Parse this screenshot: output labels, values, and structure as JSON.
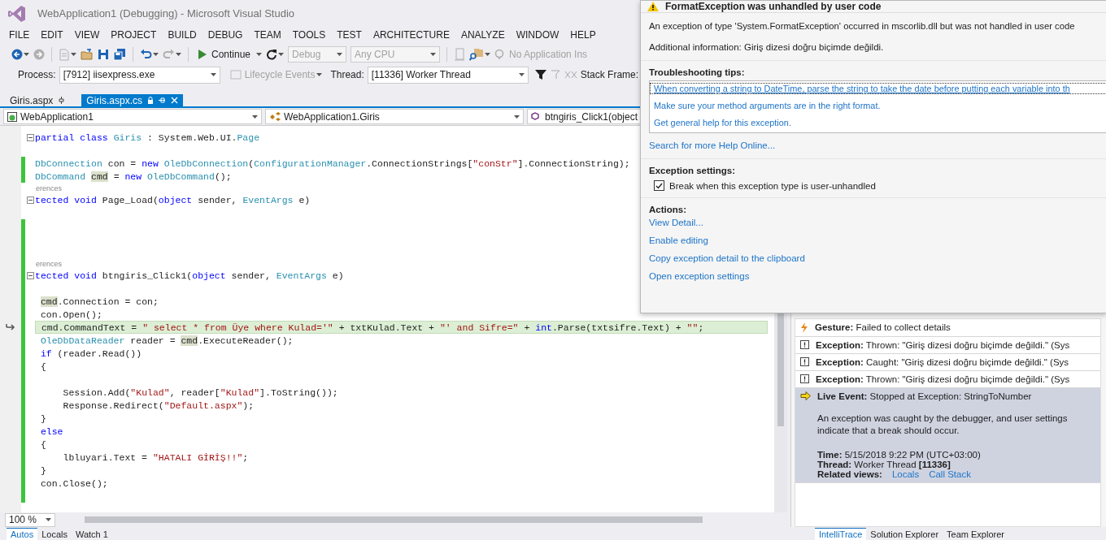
{
  "window": {
    "title": "WebApplication1 (Debugging) - Microsoft Visual Studio"
  },
  "menu": [
    "FILE",
    "EDIT",
    "VIEW",
    "PROJECT",
    "BUILD",
    "DEBUG",
    "TEAM",
    "TOOLS",
    "TEST",
    "ARCHITECTURE",
    "ANALYZE",
    "WINDOW",
    "HELP"
  ],
  "toolbar": {
    "items": [
      {
        "kind": "back",
        "disabled": false
      },
      {
        "kind": "forward",
        "disabled": true
      },
      {
        "kind": "sep"
      },
      {
        "kind": "new-item",
        "disabled": true
      },
      {
        "kind": "open",
        "disabled": false
      },
      {
        "kind": "save",
        "disabled": false
      },
      {
        "kind": "save-all",
        "disabled": false
      },
      {
        "kind": "sep"
      },
      {
        "kind": "undo",
        "disabled": false
      },
      {
        "kind": "redo",
        "disabled": true
      },
      {
        "kind": "sep"
      },
      {
        "kind": "continue",
        "label": "Continue",
        "disabled": false
      },
      {
        "kind": "restart",
        "disabled": false
      },
      {
        "kind": "combo",
        "label": "Debug",
        "disabled": true
      },
      {
        "kind": "combo",
        "label": "Any CPU",
        "disabled": true
      },
      {
        "kind": "sep"
      },
      {
        "kind": "device",
        "disabled": true
      },
      {
        "kind": "find",
        "disabled": false
      },
      {
        "kind": "insights",
        "label": "No Application Ins",
        "disabled": true
      }
    ]
  },
  "debug_bar": {
    "process_label": "Process:",
    "process": "[7912] iisexpress.exe",
    "lifecycle": {
      "label": "Lifecycle Events",
      "disabled": true
    },
    "thread_label": "Thread:",
    "thread": "[11336] Worker Thread",
    "stack_label": "Stack Frame:"
  },
  "doc_tabs": [
    {
      "label": "Giris.aspx",
      "selected": false
    },
    {
      "label": "Giris.aspx.cs",
      "selected": true
    }
  ],
  "nav_bar": [
    "WebApplication1",
    "WebApplication1.Giris",
    "btngiris_Click1(object"
  ],
  "code_lines": [
    {
      "kind": "code",
      "changed": false,
      "fold": true,
      "current": false,
      "tokens": [
        {
          "t": "partial class ",
          "kind": "kw"
        },
        {
          "t": "Giris",
          "kind": "type"
        },
        {
          "t": " : System.Web.UI.",
          "kind": "plain"
        },
        {
          "t": "Page",
          "kind": "type"
        }
      ]
    },
    {
      "kind": "blank",
      "changed": false
    },
    {
      "kind": "code",
      "changed": true,
      "fold": false,
      "current": false,
      "tokens": [
        {
          "t": "DbConnection",
          "kind": "type"
        },
        {
          "t": " con = ",
          "kind": "plain"
        },
        {
          "t": "new ",
          "kind": "kw"
        },
        {
          "t": "OleDbConnection",
          "kind": "type"
        },
        {
          "t": "(",
          "kind": "plain"
        },
        {
          "t": "ConfigurationManager",
          "kind": "type"
        },
        {
          "t": ".ConnectionStrings[",
          "kind": "plain"
        },
        {
          "t": "\"conStr\"",
          "kind": "str"
        },
        {
          "t": "].ConnectionString);",
          "kind": "plain"
        }
      ]
    },
    {
      "kind": "code",
      "changed": true,
      "fold": false,
      "current": false,
      "tokens": [
        {
          "t": "DbCommand",
          "kind": "type"
        },
        {
          "t": " cmd",
          "kind": "ref"
        },
        {
          "t": " = ",
          "kind": "plain"
        },
        {
          "t": "new ",
          "kind": "kw"
        },
        {
          "t": "OleDbCommand",
          "kind": "type"
        },
        {
          "t": "();",
          "kind": "plain"
        }
      ]
    },
    {
      "kind": "codelens",
      "changed": false,
      "text": "erences"
    },
    {
      "kind": "code",
      "changed": false,
      "fold": true,
      "current": false,
      "tokens": [
        {
          "t": "tected void",
          "kind": "kw"
        },
        {
          "t": " Page_Load(",
          "kind": "plain"
        },
        {
          "t": "object",
          "kind": "kw"
        },
        {
          "t": " sender, ",
          "kind": "plain"
        },
        {
          "t": "EventArgs",
          "kind": "type"
        },
        {
          "t": " e)",
          "kind": "plain"
        }
      ]
    },
    {
      "kind": "blank",
      "changed": false
    },
    {
      "kind": "blank",
      "changed": true
    },
    {
      "kind": "blank",
      "changed": true
    },
    {
      "kind": "blank",
      "changed": true
    },
    {
      "kind": "codelens",
      "changed": true,
      "text": "erences"
    },
    {
      "kind": "code",
      "changed": true,
      "fold": true,
      "current": false,
      "tokens": [
        {
          "t": "tected void",
          "kind": "kw"
        },
        {
          "t": " btngiris_Click1(",
          "kind": "plain"
        },
        {
          "t": "object",
          "kind": "kw"
        },
        {
          "t": " sender, ",
          "kind": "plain"
        },
        {
          "t": "EventArgs",
          "kind": "type"
        },
        {
          "t": " e)",
          "kind": "plain"
        }
      ]
    },
    {
      "kind": "blank",
      "changed": true
    },
    {
      "kind": "code",
      "changed": true,
      "fold": false,
      "current": false,
      "tokens": [
        {
          "t": " cmd",
          "kind": "ref"
        },
        {
          "t": ".Connection = con;",
          "kind": "plain"
        }
      ]
    },
    {
      "kind": "code",
      "changed": true,
      "fold": false,
      "current": false,
      "tokens": [
        {
          "t": " con.Open();",
          "kind": "plain"
        }
      ]
    },
    {
      "kind": "code",
      "changed": true,
      "fold": false,
      "current": true,
      "tokens": [
        {
          "t": " cmd.CommandText = ",
          "kind": "plain"
        },
        {
          "t": "\" select * from Üye where Kulad='\"",
          "kind": "str"
        },
        {
          "t": " + txtKulad.Text + ",
          "kind": "plain"
        },
        {
          "t": "\"' and Sifre=\"",
          "kind": "str"
        },
        {
          "t": " + ",
          "kind": "plain"
        },
        {
          "t": "int",
          "kind": "kw"
        },
        {
          "t": ".Parse(txtsifre.Text) + ",
          "kind": "plain"
        },
        {
          "t": "\"\"",
          "kind": "str"
        },
        {
          "t": ";",
          "kind": "plain"
        }
      ]
    },
    {
      "kind": "code",
      "changed": true,
      "fold": false,
      "current": false,
      "tokens": [
        {
          "t": " OleDbDataReader",
          "kind": "type"
        },
        {
          "t": " reader = ",
          "kind": "plain"
        },
        {
          "t": "cmd",
          "kind": "ref"
        },
        {
          "t": ".ExecuteReader();",
          "kind": "plain"
        }
      ]
    },
    {
      "kind": "code",
      "changed": true,
      "fold": false,
      "current": false,
      "tokens": [
        {
          "t": " if",
          "kind": "kw"
        },
        {
          "t": " (reader.Read())",
          "kind": "plain"
        }
      ]
    },
    {
      "kind": "code",
      "changed": true,
      "fold": false,
      "current": false,
      "tokens": [
        {
          "t": " {",
          "kind": "plain"
        }
      ]
    },
    {
      "kind": "blank",
      "changed": true
    },
    {
      "kind": "code",
      "changed": true,
      "fold": false,
      "current": false,
      "tokens": [
        {
          "t": "     Session.Add(",
          "kind": "plain"
        },
        {
          "t": "\"Kulad\"",
          "kind": "str"
        },
        {
          "t": ", reader[",
          "kind": "plain"
        },
        {
          "t": "\"Kulad\"",
          "kind": "str"
        },
        {
          "t": "].ToString());",
          "kind": "plain"
        }
      ]
    },
    {
      "kind": "code",
      "changed": true,
      "fold": false,
      "current": false,
      "tokens": [
        {
          "t": "     Response.Redirect(",
          "kind": "plain"
        },
        {
          "t": "\"Default.aspx\"",
          "kind": "str"
        },
        {
          "t": ");",
          "kind": "plain"
        }
      ]
    },
    {
      "kind": "code",
      "changed": true,
      "fold": false,
      "current": false,
      "tokens": [
        {
          "t": " }",
          "kind": "plain"
        }
      ]
    },
    {
      "kind": "code",
      "changed": true,
      "fold": false,
      "current": false,
      "tokens": [
        {
          "t": " else",
          "kind": "kw"
        }
      ]
    },
    {
      "kind": "code",
      "changed": true,
      "fold": false,
      "current": false,
      "tokens": [
        {
          "t": " {",
          "kind": "plain"
        }
      ]
    },
    {
      "kind": "code",
      "changed": true,
      "fold": false,
      "current": false,
      "tokens": [
        {
          "t": "     lbluyari.Text = ",
          "kind": "plain"
        },
        {
          "t": "\"HATALI GİRİŞ!!\"",
          "kind": "str"
        },
        {
          "t": ";",
          "kind": "plain"
        }
      ]
    },
    {
      "kind": "code",
      "changed": true,
      "fold": false,
      "current": false,
      "tokens": [
        {
          "t": " }",
          "kind": "plain"
        }
      ]
    },
    {
      "kind": "code",
      "changed": true,
      "fold": false,
      "current": false,
      "tokens": [
        {
          "t": " con.Close();",
          "kind": "plain"
        }
      ]
    },
    {
      "kind": "blank",
      "changed": true
    }
  ],
  "zoom": "100 %",
  "exception_popup": {
    "title": "FormatException was unhandled by user code",
    "message": "An exception of type 'System.FormatException' occurred in mscorlib.dll but was not handled in user code",
    "additional_info": "Additional information: Giriş dizesi doğru biçimde değildi.",
    "tips_heading": "Troubleshooting tips:",
    "tips": [
      {
        "text": "When converting a string to DateTime, parse the string to take the date before putting each variable into th",
        "selected": true
      },
      {
        "text": "Make sure your method arguments are in the right format.",
        "selected": false
      },
      {
        "text": "Get general help for this exception.",
        "selected": false
      }
    ],
    "help_link": "Search for more Help Online...",
    "settings_heading": "Exception settings:",
    "settings": [
      {
        "label": "Break when this exception type is user-unhandled",
        "checked": true
      }
    ],
    "actions_heading": "Actions:",
    "actions": [
      "View Detail...",
      "Enable editing",
      "Copy exception detail to the clipboard",
      "Open exception settings"
    ]
  },
  "intellitrace": {
    "events": [
      {
        "kind": "gesture",
        "selected": false,
        "text": "**Gesture:** Failed to collect details"
      },
      {
        "kind": "exception",
        "selected": false,
        "text": "**Exception:** Thrown: \"Giriş dizesi doğru biçimde değildi.\" (Sys"
      },
      {
        "kind": "exception",
        "selected": false,
        "text": "**Exception:** Caught: \"Giriş dizesi doğru biçimde değildi.\" (Sys"
      },
      {
        "kind": "exception",
        "selected": false,
        "text": "**Exception:** Thrown: \"Giriş dizesi doğru biçimde değildi.\" (Sys"
      },
      {
        "kind": "live",
        "selected": true,
        "text": "**Live Event:** Stopped at Exception: StringToNumber",
        "details": {
          "description": "An exception was caught by the debugger, and user settings indicate that a break should occur.",
          "time": "**Time:**  5/15/2018 9:22 PM (UTC+03:00)",
          "thread": "**Thread:** Worker Thread **[11336]**",
          "related_label": "Related views:",
          "related_links": [
            "Locals",
            "Call Stack"
          ]
        }
      }
    ]
  },
  "bottom_tabs_left": [
    {
      "label": "Autos",
      "selected": true
    },
    {
      "label": "Locals",
      "selected": false
    },
    {
      "label": "Watch 1",
      "selected": false
    }
  ],
  "bottom_tabs_right": [
    {
      "label": "IntelliTrace",
      "selected": true
    },
    {
      "label": "Solution Explorer",
      "selected": false
    },
    {
      "label": "Team Explorer",
      "selected": false
    }
  ]
}
